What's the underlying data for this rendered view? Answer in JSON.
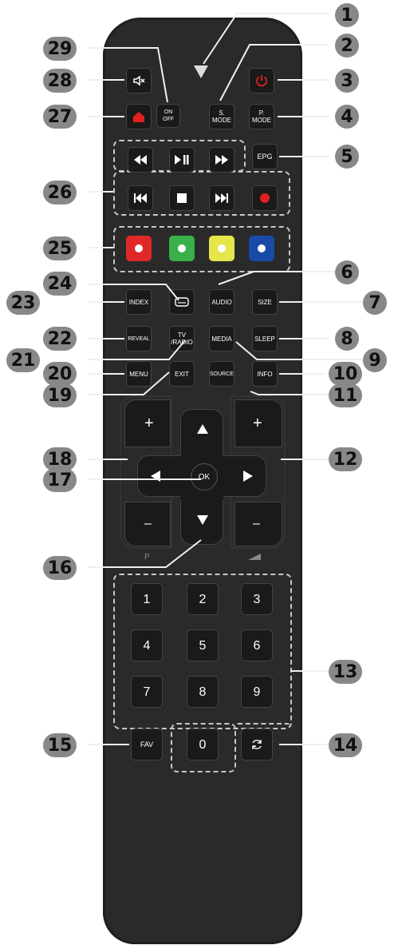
{
  "labels": {
    "s_mode": "S.\nMODE",
    "p_mode": "P.\nMODE",
    "epg": "EPG",
    "index": "INDEX",
    "audio": "AUDIO",
    "size": "SIZE",
    "reveal": "REVEAL",
    "tv_radio": "TV\n/RADIO",
    "media": "MEDIA",
    "sleep": "SLEEP",
    "menu": "MENU",
    "exit": "EXIT",
    "source": "SOURCE",
    "info": "INFO",
    "ok": "OK",
    "fav": "FAV",
    "on_off": "ON\nOFF",
    "p_label": "P",
    "plus": "+",
    "minus": "–"
  },
  "digits": [
    "1",
    "2",
    "3",
    "4",
    "5",
    "6",
    "7",
    "8",
    "9",
    "0"
  ],
  "callouts": [
    "1",
    "2",
    "3",
    "4",
    "5",
    "6",
    "7",
    "8",
    "9",
    "10",
    "11",
    "12",
    "13",
    "14",
    "15",
    "16",
    "17",
    "18",
    "19",
    "20",
    "21",
    "22",
    "23",
    "24",
    "25",
    "26",
    "27",
    "28",
    "29"
  ],
  "colors": {
    "remote_body": "#2a2a2a",
    "button": "#1a1a1a",
    "power_red": "#e02020",
    "record_red": "#e02020",
    "key_red": "#e02828",
    "key_green": "#39b049",
    "key_yellow": "#e6e64a",
    "key_blue": "#1a4aa8",
    "badge": "#888888"
  },
  "icons": {
    "mute": "mute-icon",
    "power": "power-icon",
    "home": "home-icon",
    "rewind": "rewind-icon",
    "play_pause": "play-pause-icon",
    "fast_forward": "fast-forward-icon",
    "prev": "skip-previous-icon",
    "stop": "stop-icon",
    "next": "skip-next-icon",
    "record": "record-icon",
    "subtitle": "subtitle-icon",
    "return": "return-icon"
  }
}
